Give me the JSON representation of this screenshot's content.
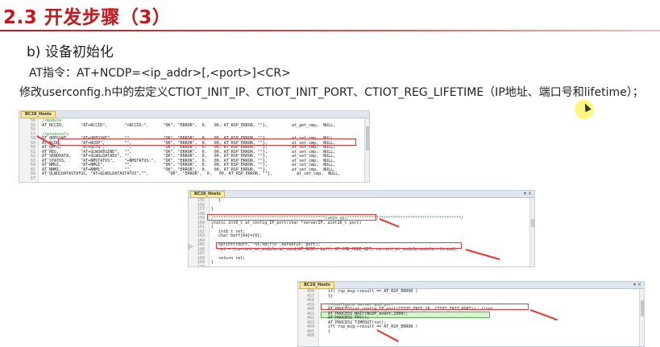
{
  "slide": {
    "title": "2.3 开发步骤（3）",
    "subheading": "b) 设备初始化",
    "at_command": "AT指令：AT+NCDP=<ip_addr>[,<port>]<CR>",
    "instruction": "修改userconfig.h中的宏定义CTIOT_INIT_IP、CTIOT_INIT_PORT、CTIOT_REG_LIFETIME（IP地址、端口号和lifetime）；"
  },
  "colors": {
    "title": "#c8161d",
    "annotation": "#e33333",
    "highlight": "#fff46a",
    "tab": "#f6e8a6"
  },
  "windows": [
    {
      "tab_label": "BC28_Hosts",
      "lines": [
        {
          "n": "56",
          "t": "//module"
        },
        {
          "n": "55",
          "t": "AT_NCCID,       \"AT+NCCID\",       \"+NCCID:\",      \"OK\", \"ERROR\",  0,   00, AT_RSP_ERROR, \"\"},          at_get_cmp,  NULL,"
        },
        {
          "n": "56",
          "t": ""
        },
        {
          "n": "57",
          "t": "//protocols"
        },
        {
          "n": "58",
          "t": "AT_QREGSWT,     \"AT+QREGSWT\",     \"\",             \"OK\", \"ERROR\",  0,   00, AT_RSP_ERROR, \"\"},          at_set_cmp,  NULL,"
        },
        {
          "n": "59",
          "t": "AT_NCDP,        \"AT+NCDP\",        \"\",             \"OK\", \"ERROR\",  0,   00, AT_RSP_ERROR, \"\"},          at_set_cmp,  NULL,"
        },
        {
          "n": "60",
          "t": "AT_QCFG,        \"AT+QCFG\",        \"\",             \"OK\", \"ERROR\",  0,   00, AT_RSP_ERROR, \"\"},          at_set_cmp,  NULL,"
        },
        {
          "n": "61",
          "t": "AT_REG,         \"AT+QLWSREGIND\",  \"\",             \"OK\", \"ERROR\",  0,   00, AT_RSP_ERROR, \"\"},          at_set_cmp,  NULL,"
        },
        {
          "n": "62",
          "t": "AT_SENDDATA,    \"AT+QLWULDATAEX\", \"\",             \"OK\", \"ERROR\",  0,   00, AT_RSP_ERROR, \"\"},          at_set_cmp,  NULL,"
        },
        {
          "n": "63",
          "t": "AT_STATUS,      \"AT+NMSTATUS\",    \"+NMSTATUS:\",   \"OK\", \"ERROR\",  0,   00, AT_RSP_ERROR, \"\"},          at_set_cmp,  NULL,"
        },
        {
          "n": "64",
          "t": "AT_NMGI,        \"AT+NMGI\",        \"\",             \"OK\", \"ERROR\",  0,   00, AT_RSP_ERROR, \"\"},          at_set_cmp,  NULL,"
        },
        {
          "n": "65",
          "t": "AT_NNMI,        \"AT+NNMI\",        \"\",             \"OK\", \"ERROR\",  0,   00, AT_RSP_ERROR, \"\"},          at_set_cmp,  NULL,"
        },
        {
          "n": "66",
          "t": "AT_QLWULDATASTATUS, \"AT+QLWULDATASTATUS\",\"\",        \"OK\", \"ERROR\",  0,   00, AT_RSP_ERROR, \"\"},          at_set_cmp,  NULL,"
        },
        {
          "n": "67",
          "t": ""
        }
      ]
    },
    {
      "tab_label": "BC28_Hosts",
      "lines": [
        {
          "n": "155",
          "t": "   }"
        },
        {
          "n": "156",
          "t": ""
        },
        {
          "n": "157",
          "t": "}"
        },
        {
          "n": "158",
          "t": ""
        },
        {
          "n": "159",
          "t": "/**********************************************lwm2m api***********************************************/"
        },
        {
          "n": "160",
          "t": "static int8_t at_config_IP_port(char *serverIP, uint16_t port)"
        },
        {
          "n": "161",
          "t": "{"
        },
        {
          "n": "162",
          "t": "   int8_t ret;"
        },
        {
          "n": "163",
          "t": "   char buff[64]={0};"
        },
        {
          "n": "164",
          "t": ""
        },
        {
          "n": "165",
          "t": "   sprintf(buff, \"%s,%d\\r\\n\",serverIP, port);"
        },
        {
          "n": "166",
          "t": "   ret = (current_at_module.at_send(AT_NCDP, buff, AT_CMD_MODE_SET, current_at_module.module->thread);"
        },
        {
          "n": "167",
          "t": ""
        },
        {
          "n": "168",
          "t": "   return ret;"
        },
        {
          "n": "169",
          "t": "}"
        },
        {
          "n": "170",
          "t": ""
        },
        {
          "n": "171",
          "t": ""
        },
        {
          "n": "172",
          "t": ""
        }
      ]
    },
    {
      "tab_label": "BC28_Hosts",
      "lines": [
        {
          "n": "456",
          "t": "   if( rsp_msg->result == AT_RSP_ERROR )"
        },
        {
          "n": "457",
          "t": "   {}"
        },
        {
          "n": "458",
          "t": ""
        },
        {
          "n": "459",
          "t": "   //configure server and port"
        },
        {
          "n": "460",
          "t": "   AT_PROCESS(at_config_IP_port(CTIOT_INIT_IP, CTIOT_INIT_PORT)); //set"
        },
        {
          "n": "461",
          "t": "   AT_PROCESS_WAIT(NCDP_event,1000);"
        },
        {
          "n": "462",
          "t": "   AT_PROCESS_TRY();"
        },
        {
          "n": "463",
          "t": "   AT_PROCESS_TIMEOUT(ret);"
        },
        {
          "n": "464",
          "t": "   if( rsp_msg->result == AT_RSP_ERROR )"
        },
        {
          "n": "465",
          "t": "   {"
        },
        {
          "n": "466",
          "t": ""
        }
      ]
    }
  ]
}
